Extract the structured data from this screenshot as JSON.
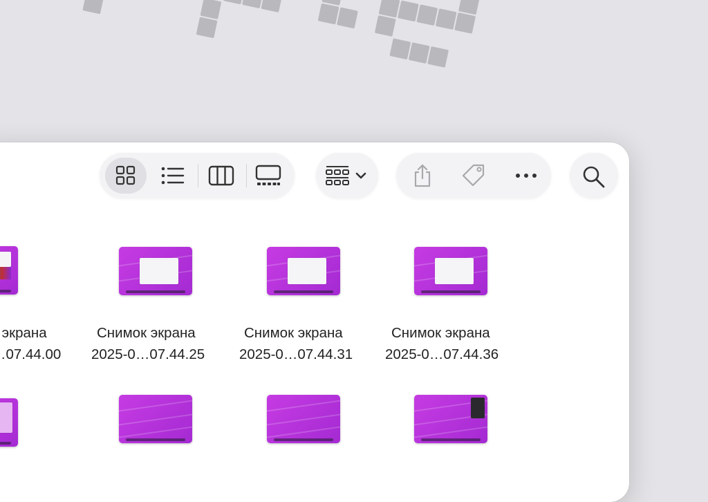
{
  "toolbar": {
    "view_buttons": [
      {
        "name": "icon-view-button",
        "icon": "grid-icon",
        "active": true
      },
      {
        "name": "list-view-button",
        "icon": "list-icon",
        "active": false
      },
      {
        "name": "column-view-button",
        "icon": "columns-icon",
        "active": false
      },
      {
        "name": "gallery-view-button",
        "icon": "gallery-icon",
        "active": false
      }
    ],
    "group_button_icon": "group-grid-icon",
    "share_icon": "share-icon",
    "tag_icon": "tag-icon",
    "more_icon": "ellipsis-icon",
    "search_icon": "search-icon"
  },
  "files": [
    {
      "line1": "к экрана",
      "line2": "…07.44.00"
    },
    {
      "line1": "Снимок экрана",
      "line2": "2025-0…07.44.25"
    },
    {
      "line1": "Снимок экрана",
      "line2": "2025-0…07.44.31"
    },
    {
      "line1": "Снимок экрана",
      "line2": "2025-0…07.44.36"
    }
  ],
  "colors": {
    "thumbnail_accent": "#b733dd",
    "window_bg": "#ffffff",
    "wallpaper_bg": "#e4e4e8"
  }
}
